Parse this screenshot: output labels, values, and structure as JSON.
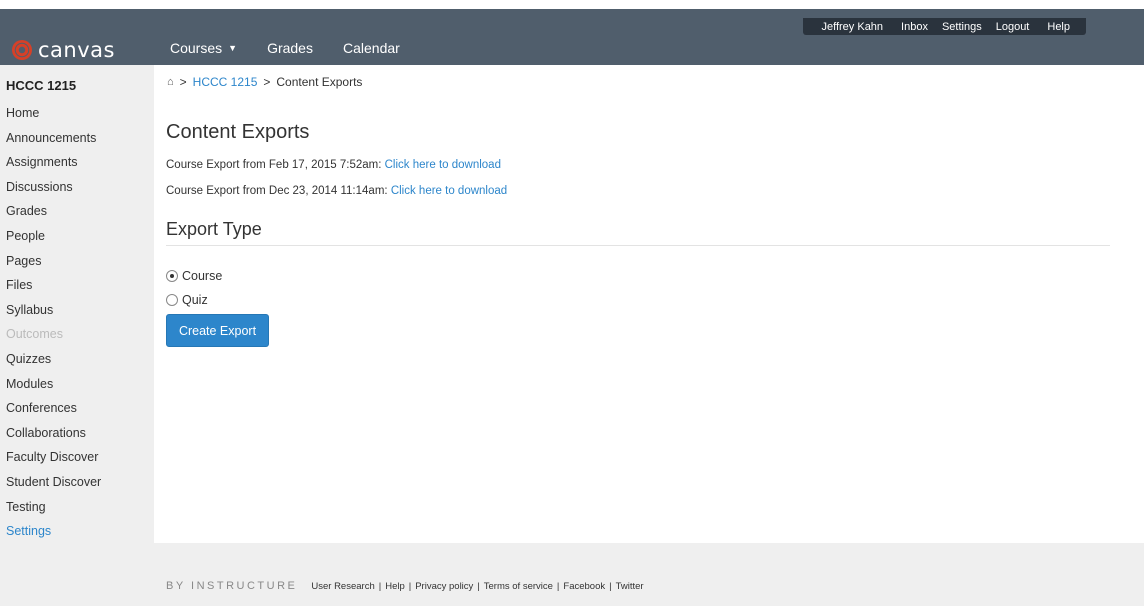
{
  "header": {
    "logo_text": "canvas",
    "user_links": [
      "Jeffrey Kahn",
      "Inbox",
      "Settings",
      "Logout",
      "Help"
    ],
    "nav": [
      {
        "label": "Courses",
        "has_caret": true
      },
      {
        "label": "Grades"
      },
      {
        "label": "Calendar"
      }
    ],
    "colors": {
      "bar": "#505e6c",
      "user_bar": "#2a333d",
      "logo_accent": "#d64027"
    }
  },
  "breadcrumb": {
    "home_icon": "home-icon",
    "separator": ">",
    "course": "HCCC 1215",
    "current": "Content Exports"
  },
  "sidebar": {
    "course_title": "HCCC 1215",
    "items": [
      {
        "label": "Home"
      },
      {
        "label": "Announcements"
      },
      {
        "label": "Assignments"
      },
      {
        "label": "Discussions"
      },
      {
        "label": "Grades"
      },
      {
        "label": "People"
      },
      {
        "label": "Pages"
      },
      {
        "label": "Files"
      },
      {
        "label": "Syllabus"
      },
      {
        "label": "Outcomes",
        "state": "disabled"
      },
      {
        "label": "Quizzes"
      },
      {
        "label": "Modules"
      },
      {
        "label": "Conferences"
      },
      {
        "label": "Collaborations"
      },
      {
        "label": "Faculty Discover"
      },
      {
        "label": "Student Discover"
      },
      {
        "label": "Testing"
      },
      {
        "label": "Settings",
        "state": "active"
      }
    ]
  },
  "main": {
    "title": "Content Exports",
    "exports": [
      {
        "text": "Course Export from Feb 17, 2015 7:52am:",
        "link": "Click here to download"
      },
      {
        "text": "Course Export from Dec 23, 2014 11:14am:",
        "link": "Click here to download"
      }
    ],
    "export_type_heading": "Export Type",
    "options": [
      {
        "label": "Course",
        "checked": true
      },
      {
        "label": "Quiz",
        "checked": false
      }
    ],
    "create_button": "Create Export",
    "colors": {
      "link": "#2d86cb",
      "button": "#2d86cb"
    }
  },
  "footer": {
    "brand": "BY INSTRUCTURE",
    "links": [
      "User Research",
      "Help",
      "Privacy policy",
      "Terms of service",
      "Facebook",
      "Twitter"
    ]
  }
}
